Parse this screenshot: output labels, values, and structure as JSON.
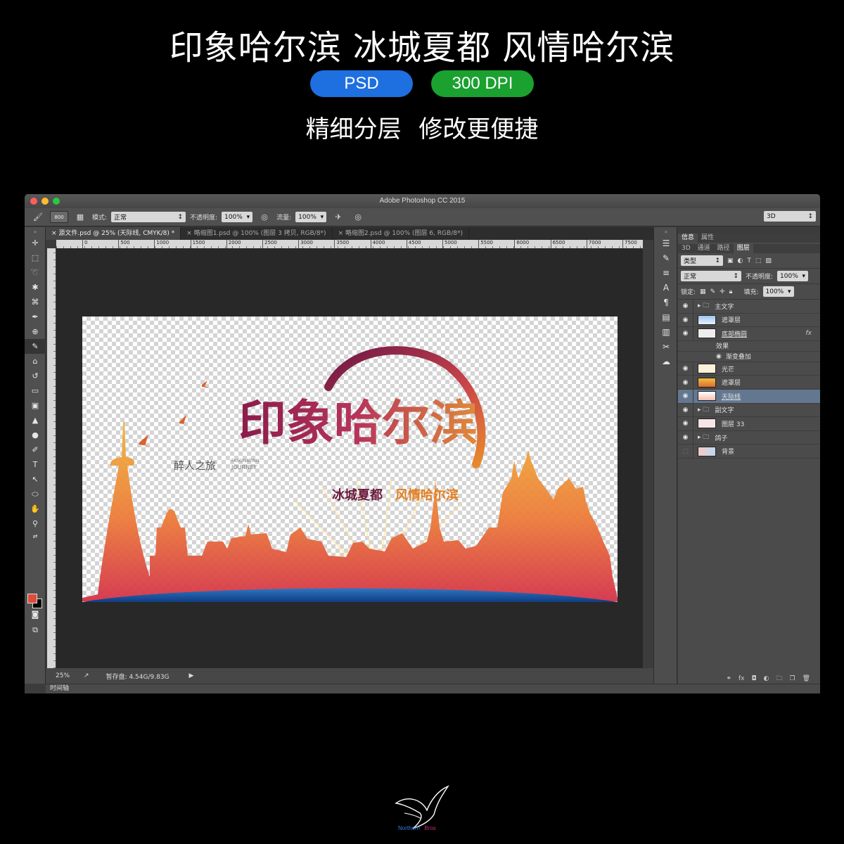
{
  "promo": {
    "headline": "印象哈尔滨 冰城夏都 风情哈尔滨",
    "badge_format": "PSD",
    "badge_dpi": "300 DPI",
    "subline": "精细分层  修改更便捷"
  },
  "window": {
    "title": "Adobe Photoshop CC 2015"
  },
  "options_bar": {
    "brush_size": "800",
    "mode_label": "模式:",
    "mode_value": "正常",
    "opacity_label": "不透明度:",
    "opacity_value": "100%",
    "flow_label": "流量:",
    "flow_value": "100%",
    "workspace": "3D"
  },
  "tabs": [
    {
      "label": "源文件.psd @ 25% (天际线, CMYK/8) *"
    },
    {
      "label": "略缩图1.psd @ 100% (图层 3 拷贝, RGB/8*)"
    },
    {
      "label": "略缩图2.psd @ 100% (图层 6, RGB/8*)"
    }
  ],
  "ruler_ticks": [
    "0",
    "500",
    "1000",
    "1500",
    "2000",
    "2500",
    "3000",
    "3500",
    "4000",
    "4500",
    "5000",
    "5500",
    "6000",
    "6500",
    "7000",
    "7500"
  ],
  "artwork": {
    "main_title": "印象哈尔滨",
    "tagline_left": "冰城夏都",
    "tagline_right": "风情哈尔滨",
    "small_cn": "醉人之旅",
    "small_en_1": "FASCINATING",
    "small_en_2": "JOURNEY"
  },
  "status": {
    "zoom": "25%",
    "scratch": "暂存盘: 4.54G/9.83G",
    "timeline": "时间轴"
  },
  "layers_panel": {
    "tabs_top": [
      "信息",
      "属性"
    ],
    "tabs": [
      "3D",
      "通道",
      "路径",
      "图层"
    ],
    "filter": "类型",
    "blend": "正常",
    "opacity_label": "不透明度:",
    "opacity": "100%",
    "lock_label": "锁定:",
    "fill_label": "填充:",
    "fill": "100%",
    "effects_label": "效果",
    "effect_name": "渐变叠加",
    "layers": [
      {
        "name": "主文字"
      },
      {
        "name": "遮罩层"
      },
      {
        "name": "底部椭圆"
      },
      {
        "name": "光芒"
      },
      {
        "name": "遮罩层"
      },
      {
        "name": "天际线"
      },
      {
        "name": "副文字"
      },
      {
        "name": "图层 33"
      },
      {
        "name": "鸽子"
      },
      {
        "name": "背景"
      }
    ]
  },
  "logo": {
    "text_left": "Northern",
    "text_right": "Bros"
  }
}
